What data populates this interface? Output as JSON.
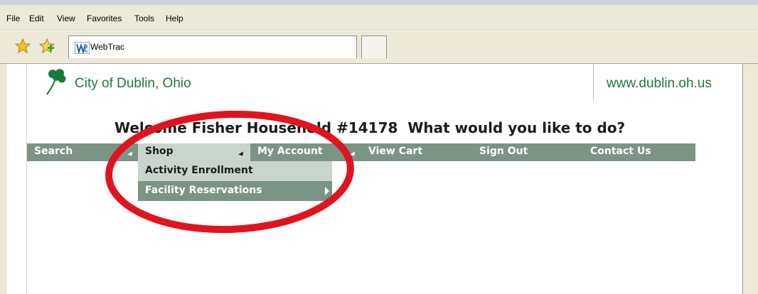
{
  "browser": {
    "menu": [
      "File",
      "Edit",
      "View",
      "Favorites",
      "Tools",
      "Help"
    ],
    "tab_title": "WebTrac"
  },
  "site": {
    "city_name": "City of Dublin, Ohio",
    "url": "www.dublin.oh.us",
    "welcome": "Welcome Fisher Household #14178  What would you like to do?"
  },
  "nav": {
    "items": [
      "Search",
      "Shop",
      "My Account",
      "View Cart",
      "Sign Out",
      "Contact Us"
    ],
    "active": "Shop"
  },
  "dropdown": {
    "items": [
      "Activity Enrollment",
      "Facility Reservations"
    ],
    "highlighted": "Facility Reservations"
  },
  "colors": {
    "nav_bg": "#7a9585",
    "nav_active_bg": "#c9d5cc",
    "brand_green": "#1a7a3a",
    "annotation_red": "#e0141e"
  }
}
